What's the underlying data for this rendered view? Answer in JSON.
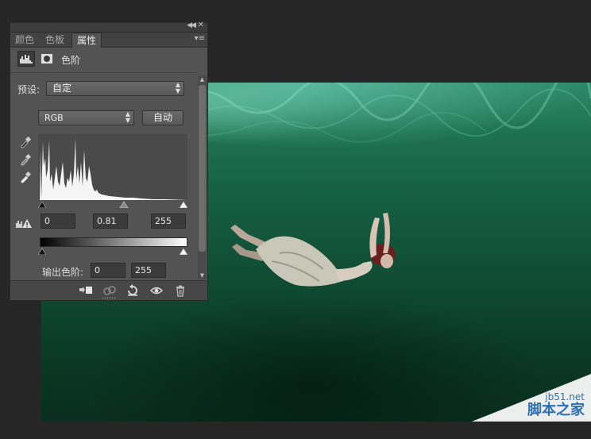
{
  "panel": {
    "tabs": [
      {
        "label": "颜色",
        "active": false
      },
      {
        "label": "色板",
        "active": false
      },
      {
        "label": "属性",
        "active": true
      }
    ],
    "adjustment_title": "色阶",
    "preset_label": "预设:",
    "preset_value": "自定",
    "channel_value": "RGB",
    "auto_button": "自动",
    "input_levels": {
      "black": "0",
      "gamma": "0.81",
      "white": "255"
    },
    "output_label": "输出色阶:",
    "output_levels": {
      "black": "0",
      "white": "255"
    },
    "icons": {
      "adjustment": "levels-histogram-icon",
      "mask": "layer-mask-icon",
      "eyedroppers": [
        "black-point-eyedropper-icon",
        "gray-point-eyedropper-icon",
        "white-point-eyedropper-icon"
      ],
      "clipping": "clipping-warning-icon",
      "footer": [
        "clip-to-layer-icon",
        "view-previous-icon",
        "reset-icon",
        "visibility-eye-icon",
        "trash-icon"
      ]
    }
  },
  "watermark": {
    "domain": "jb51.net",
    "name": "脚本之家"
  },
  "colors": {
    "ui_bg": "#262626",
    "panel_bg": "#535353",
    "water_top": "#2d8a6a",
    "water_bottom": "#0a2e1f",
    "watermark_blue": "#2d6fb5"
  }
}
